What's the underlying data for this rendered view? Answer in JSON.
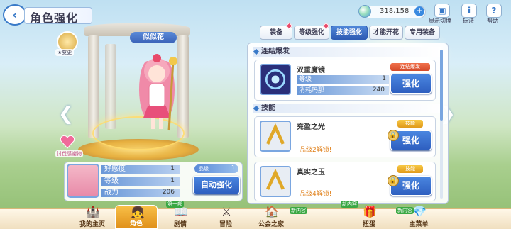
{
  "header": {
    "title": "角色强化",
    "currency": "318,158",
    "icons": [
      {
        "name": "gift-icon",
        "label": "显示切换"
      },
      {
        "name": "info-icon",
        "label": "玩法"
      },
      {
        "name": "help-icon",
        "label": "帮助"
      }
    ]
  },
  "character": {
    "name": "似似花",
    "star_label": "★变更",
    "affinity_label": "讨伐感谢物"
  },
  "stats": {
    "rows": [
      {
        "label": "好感度",
        "value": "1"
      },
      {
        "label": "等级",
        "value": "1"
      },
      {
        "label": "战力",
        "value": "206"
      }
    ],
    "rank_label": "品级",
    "rank_value": "1",
    "auto_button": "自动强化"
  },
  "tabs": [
    {
      "label": "装备",
      "dot": true
    },
    {
      "label": "等级强化",
      "dot": true
    },
    {
      "label": "技能强化",
      "active": true
    },
    {
      "label": "才能开花",
      "dot": false
    },
    {
      "label": "专用装备",
      "dot": false
    }
  ],
  "union_burst": {
    "section": "连结爆发",
    "skill_name": "双重魔镜",
    "tag": "连结爆发",
    "level_label": "等级",
    "level_value": "1",
    "cost_label": "消耗玛那",
    "cost_value": "240",
    "button": "强化"
  },
  "skills": {
    "section": "技能",
    "items": [
      {
        "name": "充盈之光",
        "tag": "技能",
        "locked_text": "品级2解锁!",
        "button": "强化"
      },
      {
        "name": "真实之玉",
        "tag": "技能",
        "locked_text": "品级4解锁!",
        "button": "强化"
      }
    ]
  },
  "nav": [
    {
      "label": "我的主页"
    },
    {
      "label": "角色",
      "active": true
    },
    {
      "label": "剧情",
      "badge": "第一部"
    },
    {
      "label": "冒险"
    },
    {
      "label": "公会之家",
      "badge": "新内容"
    },
    {
      "label": "扭蛋",
      "badge": "新内容"
    },
    {
      "label": "主菜单",
      "badge": "新内容"
    }
  ],
  "colors": {
    "accent": "#2e5fc0",
    "tab_active": "#3a6cc4",
    "locked": "#e0801a"
  }
}
